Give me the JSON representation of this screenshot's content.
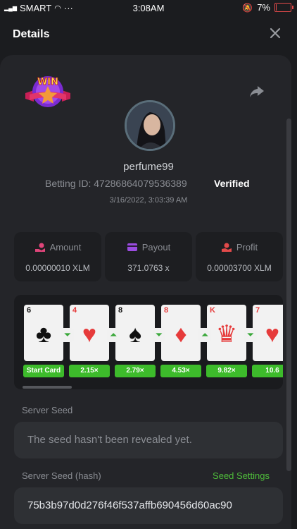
{
  "status_bar": {
    "carrier": "SMART",
    "dots": "···",
    "time": "3:08AM",
    "battery": "7%",
    "battery_fill": 0.07
  },
  "header": {
    "title": "Details",
    "close_icon": "close-icon"
  },
  "badge": {
    "text": "WIN"
  },
  "icons": {
    "share": "share-icon",
    "amount": "hand-coin-icon",
    "payout": "wallet-icon",
    "profit": "profit-icon",
    "win": "win-badge-icon"
  },
  "user": {
    "name": "perfume99",
    "betting_id_label": "Betting ID:",
    "betting_id": "47286864079536389",
    "verified": "Verified",
    "date": "3/16/2022, 3:03:39 AM"
  },
  "stats": [
    {
      "label": "Amount",
      "value": "0.00000010 XLM"
    },
    {
      "label": "Payout",
      "value": "371.0763 x"
    },
    {
      "label": "Profit",
      "value": "0.00003700 XLM"
    }
  ],
  "cards": [
    {
      "rank": "6",
      "suit": "♣",
      "color": "#111111",
      "mult": "Start Card",
      "arrow": ""
    },
    {
      "rank": "4",
      "suit": "♥",
      "color": "#e63b3b",
      "mult": "2.15×",
      "arrow": "down"
    },
    {
      "rank": "8",
      "suit": "♠",
      "color": "#111111",
      "mult": "2.79×",
      "arrow": "up"
    },
    {
      "rank": "8",
      "suit": "♦",
      "color": "#e63b3b",
      "mult": "4.53×",
      "arrow": "down"
    },
    {
      "rank": "K",
      "suit": "♛",
      "color": "#e63b3b",
      "mult": "9.82×",
      "arrow": "up"
    },
    {
      "rank": "7",
      "suit": "♥",
      "color": "#e63b3b",
      "mult": "10.6",
      "arrow": "down"
    }
  ],
  "server_seed": {
    "label": "Server Seed",
    "value": "The seed hasn't been revealed yet."
  },
  "server_seed_hash": {
    "label": "Server Seed (hash)",
    "link": "Seed Settings",
    "value": "75b3b97d0d276f46f537affb690456d60ac90"
  }
}
